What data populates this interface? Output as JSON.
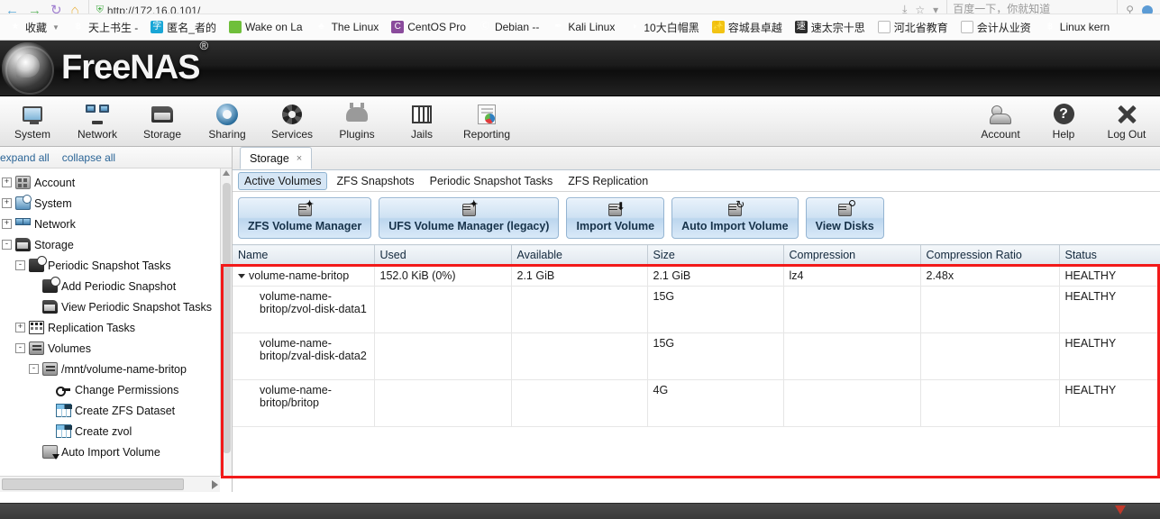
{
  "browser": {
    "url": "http://172.16.0.101/",
    "search_placeholder": "百度一下，你就知道",
    "nav": {
      "back": "←",
      "forward": "→",
      "reload": "↻",
      "home": "⌂",
      "shield": "⛨",
      "star": "☆",
      "downloads": "⤓",
      "search": "⚲"
    },
    "bookmarks": [
      {
        "label": "收藏",
        "icon": "star-icon",
        "favclass": "fav-star",
        "glyph": "★",
        "caret": true
      },
      {
        "label": "天上书生 -",
        "icon": "bookmark-icon",
        "favclass": "fav-none",
        "glyph": "฿",
        "caret": false
      },
      {
        "label": "匿名_者的",
        "icon": "bookmark-icon",
        "favclass": "fav-cyan",
        "glyph": "字",
        "caret": false
      },
      {
        "label": "Wake on La",
        "icon": "bookmark-icon",
        "favclass": "fav-green",
        "glyph": "",
        "caret": false
      },
      {
        "label": "The Linux",
        "icon": "tux-icon",
        "favclass": "fav-tux",
        "glyph": "♣",
        "caret": false
      },
      {
        "label": "CentOS Pro",
        "icon": "centos-icon",
        "favclass": "fav-purple",
        "glyph": "C",
        "caret": false
      },
      {
        "label": "Debian --",
        "icon": "debian-icon",
        "favclass": "fav-none",
        "glyph": "Ⓒ",
        "caret": false
      },
      {
        "label": "Kali Linux",
        "icon": "kali-icon",
        "favclass": "fav-none",
        "glyph": "✒",
        "caret": false
      },
      {
        "label": "10大白帽黑",
        "icon": "bookmark-icon",
        "favclass": "fav-none",
        "glyph": "◑",
        "caret": false
      },
      {
        "label": "容城县卓越",
        "icon": "bookmark-icon",
        "favclass": "fav-yellow",
        "glyph": "✨",
        "caret": false
      },
      {
        "label": "速太宗十思",
        "icon": "bookmark-icon",
        "favclass": "fav-dark",
        "glyph": "速",
        "caret": false
      },
      {
        "label": "河北省教育",
        "icon": "page-icon",
        "favclass": "fav-paper",
        "glyph": "☰",
        "caret": false
      },
      {
        "label": "会计从业资",
        "icon": "page-icon",
        "favclass": "fav-paper",
        "glyph": "☰",
        "caret": false
      },
      {
        "label": "Linux kern",
        "icon": "bookmark-icon",
        "favclass": "fav-none",
        "glyph": "฿",
        "caret": false
      }
    ]
  },
  "app": {
    "brand": "FreeNAS",
    "brand_mark": "®",
    "nav_left": [
      {
        "label": "System",
        "icon": "system-icon",
        "iconclass": "ic-mon"
      },
      {
        "label": "Network",
        "icon": "network-icon",
        "iconclass": "ic-net"
      },
      {
        "label": "Storage",
        "icon": "storage-icon",
        "iconclass": "ic-folder"
      },
      {
        "label": "Sharing",
        "icon": "sharing-icon",
        "iconclass": "ic-share"
      },
      {
        "label": "Services",
        "icon": "services-icon",
        "iconclass": "ic-gear"
      },
      {
        "label": "Plugins",
        "icon": "plugins-icon",
        "iconclass": "ic-plug"
      },
      {
        "label": "Jails",
        "icon": "jails-icon",
        "iconclass": "ic-jail"
      },
      {
        "label": "Reporting",
        "icon": "reporting-icon",
        "iconclass": "ic-report"
      }
    ],
    "nav_right": [
      {
        "label": "Account",
        "icon": "account-icon",
        "iconclass": "ic-account"
      },
      {
        "label": "Help",
        "icon": "help-icon",
        "iconclass": "ic-help",
        "glyph": "?"
      },
      {
        "label": "Log Out",
        "icon": "logout-icon",
        "iconclass": "ic-logout"
      }
    ]
  },
  "sidebar": {
    "expand_all": "expand all",
    "collapse_all": "collapse all",
    "tree": [
      {
        "label": "Account",
        "indent": 0,
        "expander": "+",
        "icon": "account-tree-icon",
        "iconclass": "ti-account"
      },
      {
        "label": "System",
        "indent": 0,
        "expander": "+",
        "icon": "system-tree-icon",
        "iconclass": "ti-system"
      },
      {
        "label": "Network",
        "indent": 0,
        "expander": "+",
        "icon": "network-tree-icon",
        "iconclass": "ti-network"
      },
      {
        "label": "Storage",
        "indent": 0,
        "expander": "-",
        "icon": "storage-tree-icon",
        "iconclass": "ti-storage"
      },
      {
        "label": "Periodic Snapshot Tasks",
        "indent": 1,
        "expander": "-",
        "icon": "periodic-snapshot-icon",
        "iconclass": "ti-snap"
      },
      {
        "label": "Add Periodic Snapshot",
        "indent": 2,
        "expander": "",
        "icon": "add-periodic-snapshot-icon",
        "iconclass": "ti-snap"
      },
      {
        "label": "View Periodic Snapshot Tasks",
        "indent": 2,
        "expander": "",
        "icon": "view-periodic-snapshot-icon",
        "iconclass": "ti-storage"
      },
      {
        "label": "Replication Tasks",
        "indent": 1,
        "expander": "+",
        "icon": "replication-tasks-icon",
        "iconclass": "ti-replication"
      },
      {
        "label": "Volumes",
        "indent": 1,
        "expander": "-",
        "icon": "volumes-icon",
        "iconclass": "ti-volumes"
      },
      {
        "label": "/mnt/volume-name-britop",
        "indent": 2,
        "expander": "-",
        "icon": "volume-mount-icon",
        "iconclass": "ti-volumes"
      },
      {
        "label": "Change Permissions",
        "indent": 3,
        "expander": "",
        "icon": "key-icon",
        "iconclass": "ti-key"
      },
      {
        "label": "Create ZFS Dataset",
        "indent": 3,
        "expander": "",
        "icon": "dataset-icon",
        "iconclass": "ti-dataset"
      },
      {
        "label": "Create zvol",
        "indent": 3,
        "expander": "",
        "icon": "zvol-icon",
        "iconclass": "ti-dataset"
      },
      {
        "label": "Auto Import Volume",
        "indent": 2,
        "expander": "",
        "icon": "auto-import-icon",
        "iconclass": "ti-autoimport"
      }
    ]
  },
  "content": {
    "tab": {
      "label": "Storage",
      "close": "×"
    },
    "subtabs": [
      {
        "label": "Active Volumes",
        "active": true
      },
      {
        "label": "ZFS Snapshots",
        "active": false
      },
      {
        "label": "Periodic Snapshot Tasks",
        "active": false
      },
      {
        "label": "ZFS Replication",
        "active": false
      }
    ],
    "toolbar_buttons": [
      {
        "label": "ZFS Volume Manager",
        "icon": "zfs-volume-manager-icon",
        "badge": "plus"
      },
      {
        "label": "UFS Volume Manager (legacy)",
        "icon": "ufs-volume-manager-icon",
        "badge": "plus"
      },
      {
        "label": "Import Volume",
        "icon": "import-volume-icon",
        "badge": "down"
      },
      {
        "label": "Auto Import Volume",
        "icon": "auto-import-volume-icon",
        "badge": "rot"
      },
      {
        "label": "View Disks",
        "icon": "view-disks-icon",
        "badge": "mag"
      }
    ],
    "table": {
      "columns": [
        "Name",
        "Used",
        "Available",
        "Size",
        "Compression",
        "Compression Ratio",
        "Status"
      ],
      "rows": [
        {
          "name": "volume-name-britop",
          "used": "152.0 KiB (0%)",
          "available": "2.1 GiB",
          "size": "2.1 GiB",
          "compression": "lz4",
          "compression_ratio": "2.48x",
          "status": "HEALTHY",
          "child": false,
          "expanded": true
        },
        {
          "name": "volume-name-britop/zvol-disk-data1",
          "used": "",
          "available": "",
          "size": "15G",
          "compression": "",
          "compression_ratio": "",
          "status": "HEALTHY",
          "child": true,
          "expanded": false
        },
        {
          "name": "volume-name-britop/zval-disk-data2",
          "used": "",
          "available": "",
          "size": "15G",
          "compression": "",
          "compression_ratio": "",
          "status": "HEALTHY",
          "child": true,
          "expanded": false
        },
        {
          "name": "volume-name-britop/britop",
          "used": "",
          "available": "",
          "size": "4G",
          "compression": "",
          "compression_ratio": "",
          "status": "HEALTHY",
          "child": true,
          "expanded": false
        }
      ]
    }
  },
  "annotation": {
    "color": "#f21a1a",
    "shape": "rectangle"
  }
}
